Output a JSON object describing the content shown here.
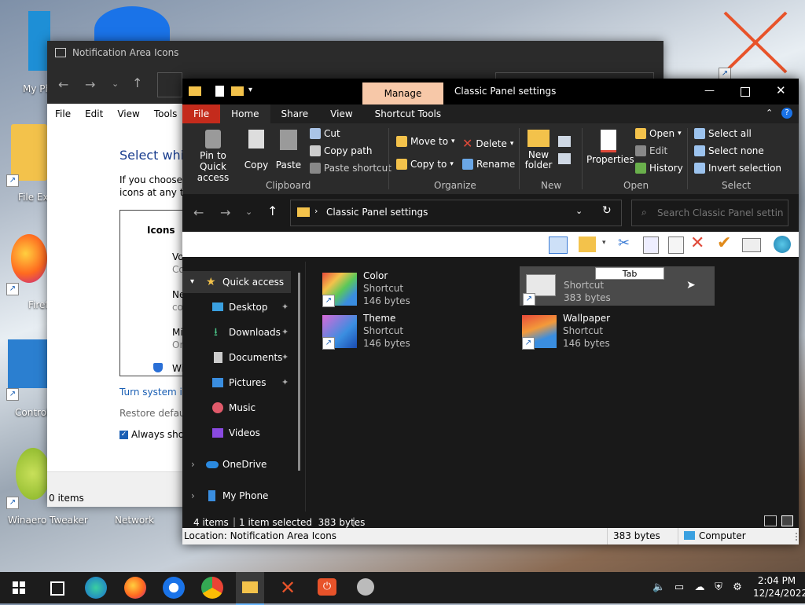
{
  "desktop": {
    "icons": [
      {
        "label": "My Ph"
      },
      {
        "label": "File Exp"
      },
      {
        "label": "Firef"
      },
      {
        "label": "Control"
      },
      {
        "label": "Winaero Tweaker"
      },
      {
        "label": "Network"
      }
    ]
  },
  "bg_window": {
    "title": "Notification Area Icons",
    "menu": [
      "File",
      "Edit",
      "View",
      "Tools"
    ],
    "heading": "Select which",
    "desc1": "If you choose t",
    "desc2": "icons at any tin",
    "col_icons": "Icons",
    "rows": [
      {
        "a": "Vo",
        "b": "Co"
      },
      {
        "a": "Ne",
        "b": "co"
      },
      {
        "a": "Mi",
        "b": "Or"
      },
      {
        "a": "Wi",
        "b": ""
      }
    ],
    "link": "Turn system ico",
    "restore": "Restore default",
    "always_show": "Always show",
    "status": "0 items"
  },
  "explorer": {
    "title": "Classic Panel settings",
    "manage_tab": "Manage",
    "tabs": [
      "File",
      "Home",
      "Share",
      "View",
      "Shortcut Tools"
    ],
    "ribbon": {
      "clipboard": {
        "label": "Clipboard",
        "pin": "Pin to Quick access",
        "copy": "Copy",
        "paste": "Paste",
        "cut": "Cut",
        "copy_path": "Copy path",
        "paste_shortcut": "Paste shortcut"
      },
      "organize": {
        "label": "Organize",
        "move_to": "Move to",
        "copy_to": "Copy to",
        "delete": "Delete",
        "rename": "Rename"
      },
      "new": {
        "label": "New",
        "new_folder": "New folder"
      },
      "open": {
        "label": "Open",
        "properties": "Properties",
        "open": "Open",
        "edit": "Edit",
        "history": "History"
      },
      "select": {
        "label": "Select",
        "select_all": "Select all",
        "select_none": "Select none",
        "invert": "Invert selection"
      }
    },
    "address": "Classic Panel settings",
    "search_placeholder": "Search Classic Panel settings",
    "nav": [
      {
        "label": "Quick access"
      },
      {
        "label": "Desktop"
      },
      {
        "label": "Downloads"
      },
      {
        "label": "Documents"
      },
      {
        "label": "Pictures"
      },
      {
        "label": "Music"
      },
      {
        "label": "Videos"
      },
      {
        "label": "OneDrive"
      },
      {
        "label": "My Phone"
      }
    ],
    "files": [
      {
        "name": "Color",
        "type": "Shortcut",
        "size": "146 bytes"
      },
      {
        "name": "Tab",
        "type": "Shortcut",
        "size": "383 bytes"
      },
      {
        "name": "Theme",
        "type": "Shortcut",
        "size": "146 bytes"
      },
      {
        "name": "Wallpaper",
        "type": "Shortcut",
        "size": "146 bytes"
      }
    ],
    "status": {
      "count": "4 items",
      "selected": "1 item selected  383 bytes"
    },
    "details": {
      "location": "Location: Notification Area Icons",
      "size": "383 bytes",
      "computer": "Computer"
    }
  },
  "taskbar": {
    "time": "2:04 PM",
    "date": "12/24/2022"
  }
}
